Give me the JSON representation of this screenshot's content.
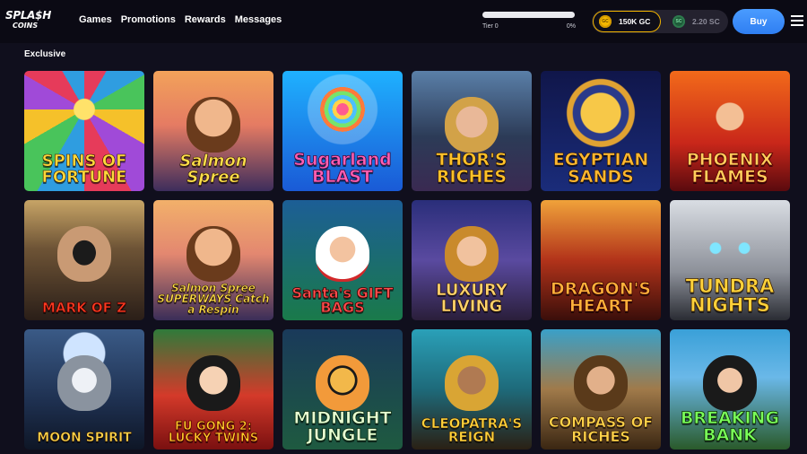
{
  "brand": {
    "logo_top": "SPLA$H",
    "logo_bottom": "COINS"
  },
  "nav": {
    "items": [
      "Games",
      "Promotions",
      "Rewards",
      "Messages"
    ]
  },
  "tier": {
    "label": "Tier 0",
    "percent_text": "0%",
    "progress": 0
  },
  "wallet": {
    "gc_icon": "GC",
    "gc_amount": "150K GC",
    "sc_icon": "SC",
    "sc_amount": "2.20 SC"
  },
  "buy_label": "Buy",
  "section": {
    "title": "Exclusive"
  },
  "games": [
    {
      "title": "SPINS OF FORTUNE"
    },
    {
      "title": "Salmon Spree"
    },
    {
      "title": "Sugarland BLAST"
    },
    {
      "title": "THOR'S RICHES"
    },
    {
      "title": "EGYPTIAN SANDS"
    },
    {
      "title": "PHOENIX FLAMES"
    },
    {
      "title": "MARK OF Z"
    },
    {
      "title": "Salmon Spree SUPERWAYS Catch a Respin"
    },
    {
      "title": "Santa's GIFT BAGS"
    },
    {
      "title": "LUXURY LIVING"
    },
    {
      "title": "DRAGON'S HEART"
    },
    {
      "title": "TUNDRA NIGHTS"
    },
    {
      "title": "MOON SPIRIT"
    },
    {
      "title": "FU GONG 2: LUCKY TWINS"
    },
    {
      "title": "MIDNIGHT JUNGLE"
    },
    {
      "title": "CLEOPATRA'S REIGN"
    },
    {
      "title": "COMPASS OF RICHES"
    },
    {
      "title": "BREAKING BANK"
    }
  ]
}
